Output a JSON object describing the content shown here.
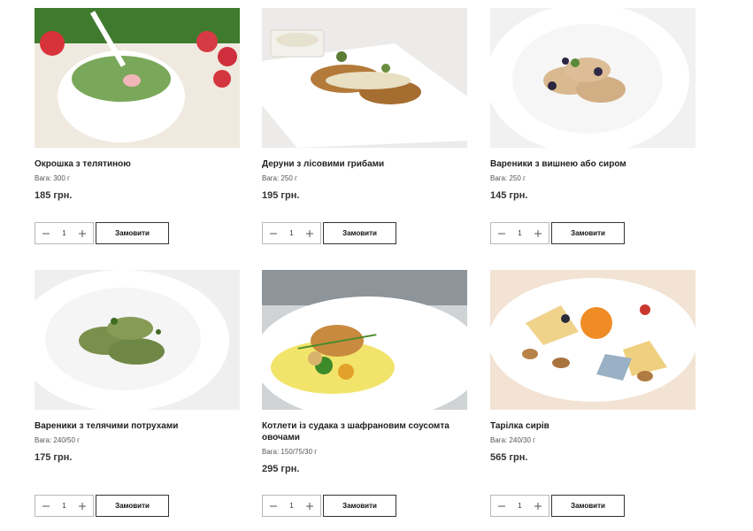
{
  "products": [
    {
      "name": "Окрошка з телятиною",
      "weight": "Вага: 300 г",
      "price": "185 грн.",
      "qty": "1",
      "order": "Замовити"
    },
    {
      "name": "Деруни з лісовими грибами",
      "weight": "Вага: 250 г",
      "price": "195 грн.",
      "qty": "1",
      "order": "Замовити"
    },
    {
      "name": "Вареники з вишнею або сиром",
      "weight": "Вага: 250 г",
      "price": "145 грн.",
      "qty": "1",
      "order": "Замовити"
    },
    {
      "name": "Вареники з телячими потрухами",
      "weight": "Вага: 240/50 г",
      "price": "175 грн.",
      "qty": "1",
      "order": "Замовити"
    },
    {
      "name": "Котлети із судака з шафрановим соусомта овочами",
      "weight": "Вага: 150/75/30 г",
      "price": "295 грн.",
      "qty": "1",
      "order": "Замовити"
    },
    {
      "name": "Тарілка сирів",
      "weight": "Вага: 240/30 г",
      "price": "565 грн.",
      "qty": "1",
      "order": "Замовити"
    }
  ],
  "icons": {
    "minus": "minus-icon",
    "plus": "plus-icon"
  }
}
